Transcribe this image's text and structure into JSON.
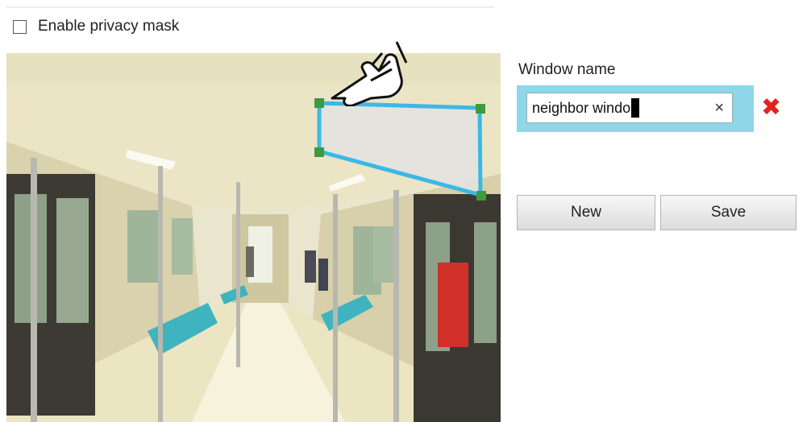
{
  "privacy_mask": {
    "label": "Enable privacy mask",
    "checked": false
  },
  "window_name": {
    "label": "Window name",
    "value": "neighbor windo",
    "clear_glyph": "×",
    "delete_glyph": "✖"
  },
  "buttons": {
    "new_label": "New",
    "save_label": "Save"
  },
  "icons": [
    "checkbox-icon",
    "pointing-hand-icon",
    "clear-icon",
    "delete-icon"
  ],
  "colors": {
    "mask_outline": "#3cb8e6",
    "mask_handle": "#3d9a3d",
    "input_highlight": "#8fd6e8",
    "delete": "#e0231f"
  }
}
